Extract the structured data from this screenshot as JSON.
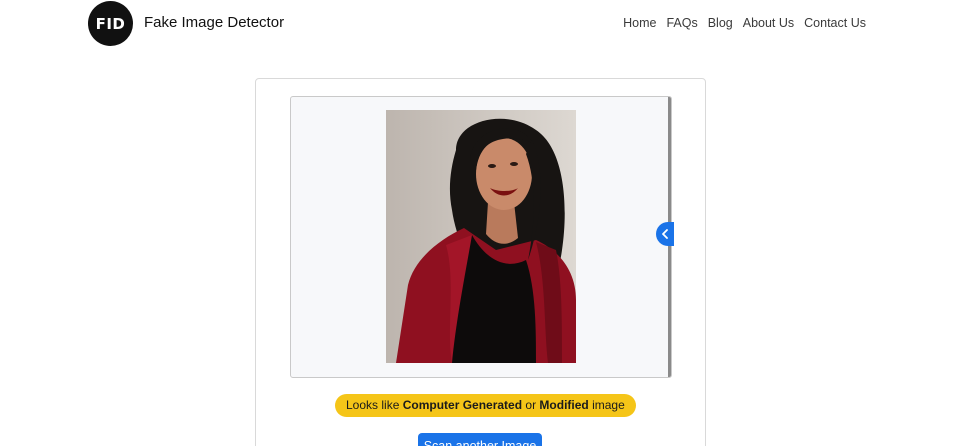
{
  "header": {
    "logo_text": "FID",
    "brand": "Fake Image Detector",
    "nav": [
      "Home",
      "FAQs",
      "Blog",
      "About Us",
      "Contact Us"
    ]
  },
  "viewer": {
    "image_subject": "portrait-photo-woman-red-coat",
    "collapse_icon": "chevron-left-icon"
  },
  "result": {
    "prefix": "Looks like ",
    "strong1": "Computer Generated",
    "middle": " or ",
    "strong2": "Modified",
    "suffix": " image"
  },
  "actions": {
    "scan_label": "Scan another Image"
  },
  "colors": {
    "accent_blue": "#1a73e8",
    "warning_yellow": "#f5c518",
    "logo_black": "#111111"
  }
}
